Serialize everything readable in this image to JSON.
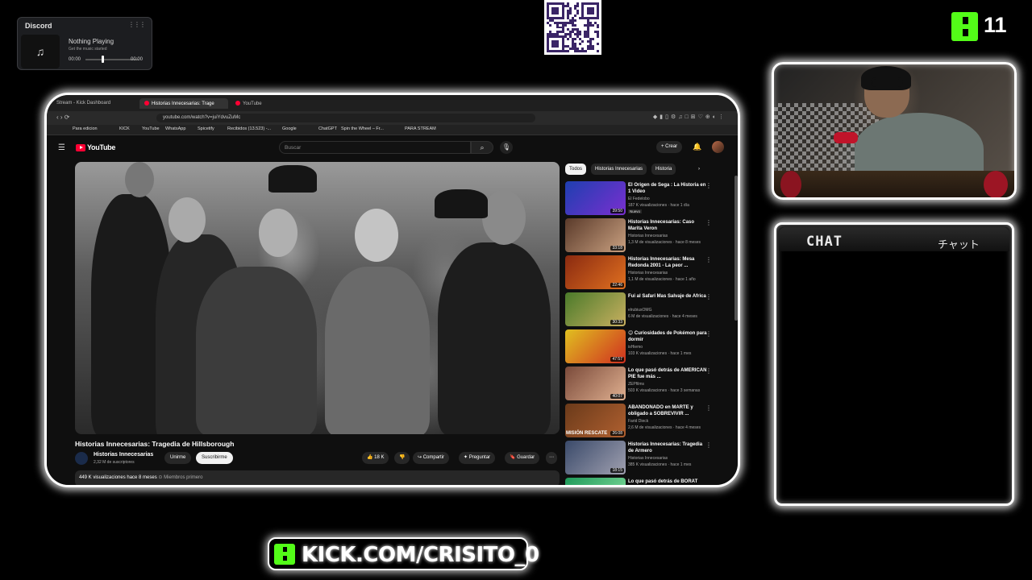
{
  "discord": {
    "title": "Discord",
    "now_playing": "Nothing Playing",
    "subtitle": "Get the music started",
    "time_start": "00:00",
    "time_end": "00:00"
  },
  "kick_top": {
    "viewer_count": "11"
  },
  "browser": {
    "tabs": [
      {
        "label": "Stream - Kick Dashboard"
      },
      {
        "label": "Historias Innecesarias: Trage"
      },
      {
        "label": "YouTube"
      }
    ],
    "url": "youtube.com/watch?v=juiYdvuZuMc",
    "bookmarks": [
      "Para edicion",
      "KICK",
      "YouTube",
      "WhatsApp",
      "Spicetify",
      "Recibidos (13.523) -...",
      "Google",
      "ChatGPT",
      "Spin the Wheel – Fr...",
      "PARA STREAM"
    ]
  },
  "youtube": {
    "logo": "YouTube",
    "search_placeholder": "Buscar",
    "create_label": "+ Crear",
    "video": {
      "title": "Historias Innecesarias: Tragedia de Hillsborough",
      "channel": "Historias Innecesarias",
      "subscribers": "2,32 M de suscriptores",
      "join_label": "Unirme",
      "subscribe_label": "Suscribirme",
      "likes": "18 K",
      "share_label": "Compartir",
      "ask_label": "Preguntar",
      "save_label": "Guardar",
      "views_line": "449 K visualizaciones  hace 8 meses",
      "members_label": "Miembros primero"
    },
    "chips": [
      "Todos",
      "Historias Innecesarias",
      "Historia"
    ],
    "recommendations": [
      {
        "title": "El Origen de Sega : La Historia en 1 Video",
        "channel": "El Fedelobo",
        "meta": "187 K visualizaciones · hace 1 día",
        "badge": "Nuevo",
        "duration": "39:50",
        "thumb_colors": [
          "#1e3fb0",
          "#7a2fd0"
        ]
      },
      {
        "title": "Historias Innecesarias: Caso Marita Veron",
        "channel": "Historias Innecesarias",
        "meta": "1,3 M de visualizaciones · hace 8 meses",
        "badge": "",
        "duration": "33:18",
        "thumb_colors": [
          "#5a3a2a",
          "#c9a080"
        ]
      },
      {
        "title": "Historias Innecesarias: Mesa Redonda 2001 - La peor ...",
        "channel": "Historias Innecesarias",
        "meta": "1,1 M de visualizaciones · hace 1 año",
        "badge": "",
        "duration": "22:46",
        "thumb_colors": [
          "#8a2a10",
          "#e07020"
        ]
      },
      {
        "title": "Fui al Safari Mas Salvaje de Africa",
        "channel": "elrubiusOMG",
        "meta": "6 M de visualizaciones · hace 4 meses",
        "badge": "",
        "duration": "30:33",
        "thumb_colors": [
          "#4a7a2a",
          "#c9b060"
        ]
      },
      {
        "title": "😊 Curiosidades de Pokémon para dormir",
        "channel": "isHiemo",
        "meta": "103 K visualizaciones · hace 1 mes",
        "badge": "",
        "duration": "47:57",
        "thumb_colors": [
          "#e0c020",
          "#d03020"
        ]
      },
      {
        "title": "Lo que pasó detrás de AMERICAN PIE fue más ...",
        "channel": "ZEPfilms",
        "meta": "503 K visualizaciones · hace 3 semanas",
        "badge": "",
        "duration": "40:07",
        "thumb_colors": [
          "#7a4a3a",
          "#e0b090"
        ]
      },
      {
        "title": "ABANDONADO en MARTE y obligado a SOBREVIVIR ...",
        "channel": "Farid Dieck",
        "meta": "2,6 M de visualizaciones · hace 4 meses",
        "badge": "",
        "duration": "26:08",
        "thumb_colors": [
          "#6a3a1a",
          "#b06030"
        ],
        "caption": "MISIÓN RESCATE"
      },
      {
        "title": "Historias Innecesarias: Tragedia de Armero",
        "channel": "Historias Innecesarias",
        "meta": "385 K visualizaciones · hace 1 mes",
        "badge": "",
        "duration": "18:15",
        "thumb_colors": [
          "#3a4a6a",
          "#a0a0b0"
        ]
      }
    ],
    "partial_next": "Lo que pasó detrás de BORAT"
  },
  "chat": {
    "title": "CHAT",
    "title_jp": "チャット"
  },
  "footer": {
    "kick_url": "KICK.COM/CRISITO_0"
  },
  "colors": {
    "kick_green": "#53fc18",
    "youtube_red": "#ff0033",
    "background": "#000000"
  }
}
